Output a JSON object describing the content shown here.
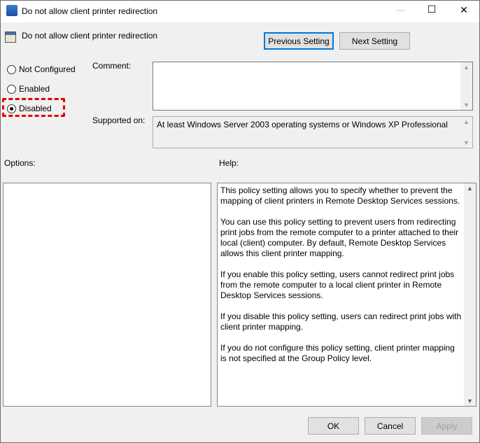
{
  "window": {
    "title": "Do not allow client printer redirection",
    "minimize": "—",
    "maximize": "☐",
    "close": "✕"
  },
  "header": {
    "policy_name": "Do not allow client printer redirection",
    "previous": "Previous Setting",
    "next": "Next Setting"
  },
  "state": {
    "options": [
      "Not Configured",
      "Enabled",
      "Disabled"
    ],
    "selected": "Disabled",
    "highlight_color": "#e00000"
  },
  "comment": {
    "label": "Comment:",
    "value": ""
  },
  "supported": {
    "label": "Supported on:",
    "value": "At least Windows Server 2003 operating systems or Windows XP Professional"
  },
  "options_label": "Options:",
  "help_label": "Help:",
  "help_paragraphs": [
    "This policy setting allows you to specify whether to prevent the mapping of client printers in Remote Desktop Services sessions.",
    "You can use this policy setting to prevent users from redirecting print jobs from the remote computer to a printer attached to their local (client) computer. By default, Remote Desktop Services allows this client printer mapping.",
    "If you enable this policy setting, users cannot redirect print jobs from the remote computer to a local client printer in Remote Desktop Services sessions.",
    "If you disable this policy setting, users can redirect print jobs with client printer mapping.",
    "If you do not configure this policy setting, client printer mapping is not specified at the Group Policy level."
  ],
  "footer": {
    "ok": "OK",
    "cancel": "Cancel",
    "apply": "Apply"
  }
}
